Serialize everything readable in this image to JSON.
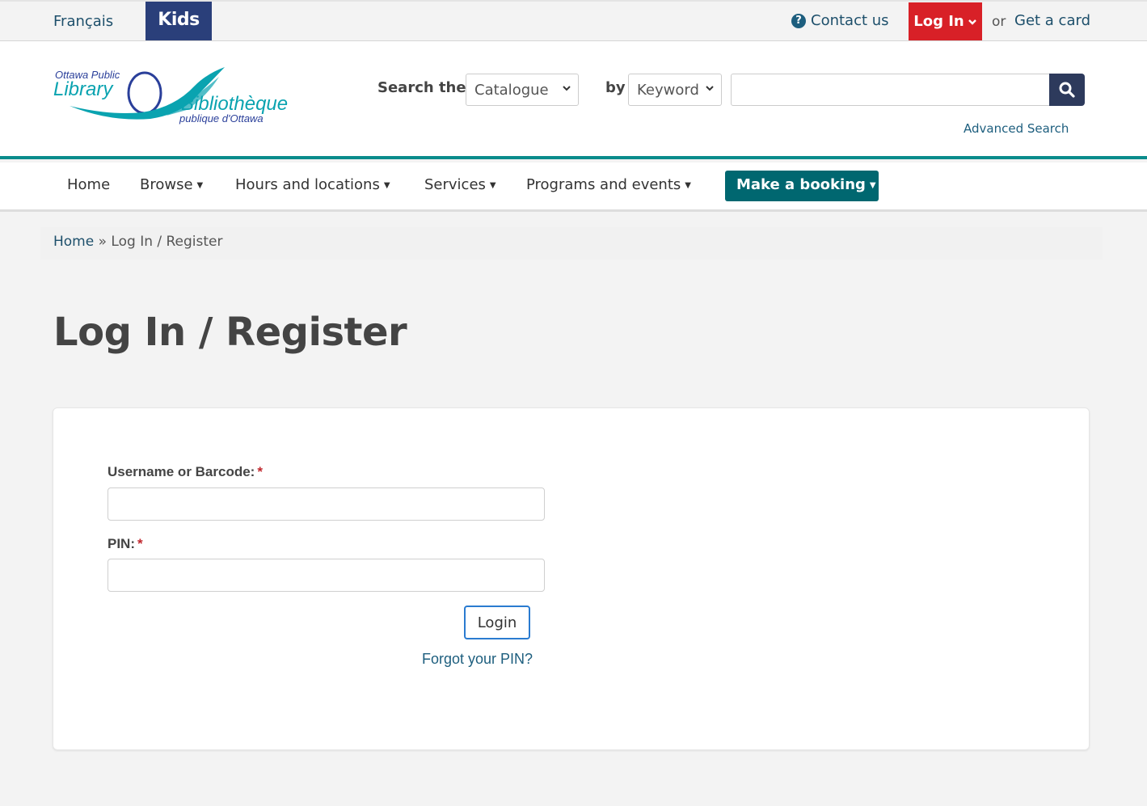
{
  "utility": {
    "language": "Français",
    "kids": "Kids",
    "contact": "Contact us",
    "login": "Log In",
    "or": "or",
    "get_card": "Get a card"
  },
  "logo": {
    "line1": "Ottawa Public",
    "line2": "Library",
    "line3": "Bibliothèque",
    "line4": "publique d'Ottawa"
  },
  "search": {
    "label": "Search the",
    "scope_selected": "Catalogue",
    "by_label": "by",
    "field_selected": "Keyword",
    "query": "",
    "advanced": "Advanced Search"
  },
  "nav": {
    "items": [
      {
        "label": "Home"
      },
      {
        "label": "Browse"
      },
      {
        "label": "Hours and locations"
      },
      {
        "label": "Services"
      },
      {
        "label": "Programs and events"
      }
    ],
    "booking": "Make a booking"
  },
  "breadcrumb": {
    "home": "Home",
    "separator": "»",
    "current": "Log In / Register"
  },
  "page": {
    "title": "Log In / Register"
  },
  "form": {
    "username_label": "Username or Barcode:",
    "pin_label": "PIN:",
    "required_mark": "*",
    "username_value": "",
    "pin_value": "",
    "submit": "Login",
    "forgot": "Forgot your PIN?"
  },
  "colors": {
    "brand_teal": "#0a8c8c",
    "kids_blue": "#2a3f7a",
    "login_red": "#d82027",
    "booking_teal": "#006770",
    "search_button": "#2d3a5c"
  }
}
